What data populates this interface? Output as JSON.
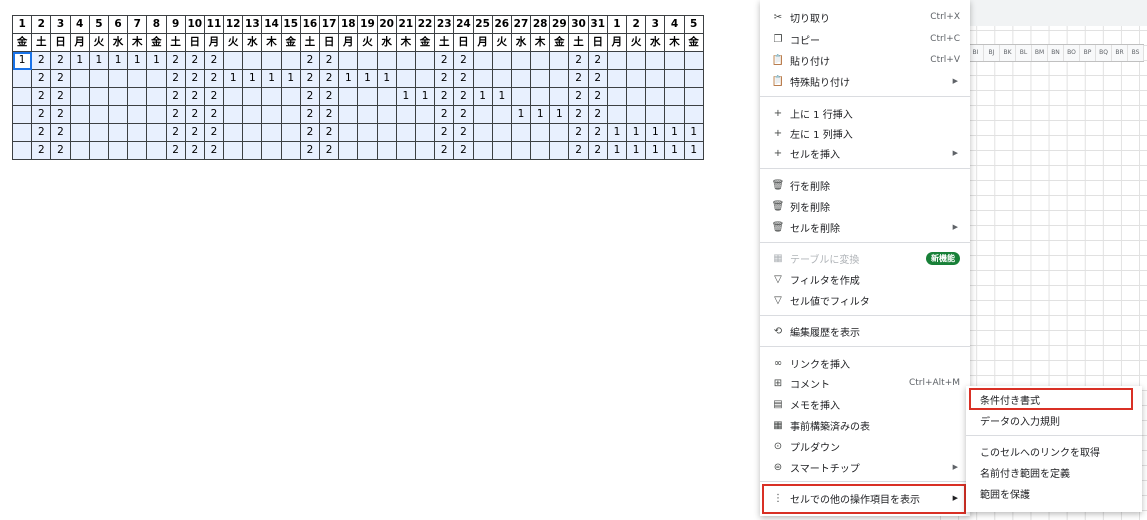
{
  "sheet": {
    "days": [
      "1",
      "2",
      "3",
      "4",
      "5",
      "6",
      "7",
      "8",
      "9",
      "10",
      "11",
      "12",
      "13",
      "14",
      "15",
      "16",
      "17",
      "18",
      "19",
      "20",
      "21",
      "22",
      "23",
      "24",
      "25",
      "26",
      "27",
      "28",
      "29",
      "30",
      "31",
      "1",
      "2",
      "3",
      "4",
      "5"
    ],
    "weekdays": [
      "金",
      "土",
      "日",
      "月",
      "火",
      "水",
      "木",
      "金",
      "土",
      "日",
      "月",
      "火",
      "水",
      "木",
      "金",
      "土",
      "日",
      "月",
      "火",
      "水",
      "木",
      "金",
      "土",
      "日",
      "月",
      "火",
      "水",
      "木",
      "金",
      "土",
      "日",
      "月",
      "火",
      "水",
      "木",
      "金"
    ],
    "rows": [
      [
        "1",
        "2",
        "2",
        "1",
        "1",
        "1",
        "1",
        "1",
        "2",
        "2",
        "2",
        "",
        "",
        "",
        "",
        "2",
        "2",
        "",
        "",
        "",
        "",
        "",
        "2",
        "2",
        "",
        "",
        "",
        "",
        "",
        "2",
        "2",
        "",
        "",
        "",
        "",
        ""
      ],
      [
        "",
        "2",
        "2",
        "",
        "",
        "",
        "",
        "",
        "2",
        "2",
        "2",
        "1",
        "1",
        "1",
        "1",
        "2",
        "2",
        "1",
        "1",
        "1",
        "",
        "",
        "2",
        "2",
        "",
        "",
        "",
        "",
        "",
        "2",
        "2",
        "",
        "",
        "",
        "",
        ""
      ],
      [
        "",
        "2",
        "2",
        "",
        "",
        "",
        "",
        "",
        "2",
        "2",
        "2",
        "",
        "",
        "",
        "",
        "2",
        "2",
        "",
        "",
        "",
        "1",
        "1",
        "2",
        "2",
        "1",
        "1",
        "",
        "",
        "",
        "2",
        "2",
        "",
        "",
        "",
        "",
        ""
      ],
      [
        "",
        "2",
        "2",
        "",
        "",
        "",
        "",
        "",
        "2",
        "2",
        "2",
        "",
        "",
        "",
        "",
        "2",
        "2",
        "",
        "",
        "",
        "",
        "",
        "2",
        "2",
        "",
        "",
        "1",
        "1",
        "1",
        "2",
        "2",
        "",
        "",
        "",
        "",
        ""
      ],
      [
        "",
        "2",
        "2",
        "",
        "",
        "",
        "",
        "",
        "2",
        "2",
        "2",
        "",
        "",
        "",
        "",
        "2",
        "2",
        "",
        "",
        "",
        "",
        "",
        "2",
        "2",
        "",
        "",
        "",
        "",
        "",
        "2",
        "2",
        "1",
        "1",
        "1",
        "1",
        "1"
      ],
      [
        "",
        "2",
        "2",
        "",
        "",
        "",
        "",
        "",
        "2",
        "2",
        "2",
        "",
        "",
        "",
        "",
        "2",
        "2",
        "",
        "",
        "",
        "",
        "",
        "2",
        "2",
        "",
        "",
        "",
        "",
        "",
        "2",
        "2",
        "1",
        "1",
        "1",
        "1",
        "1"
      ]
    ]
  },
  "bg_columns": [
    "BI",
    "BJ",
    "BK",
    "BL",
    "BM",
    "BN",
    "BO",
    "BP",
    "BQ",
    "BR",
    "BS"
  ],
  "menu": {
    "cut": {
      "label": "切り取り",
      "shortcut": "Ctrl+X",
      "icon": "scissors-icon"
    },
    "copy": {
      "label": "コピー",
      "shortcut": "Ctrl+C",
      "icon": "copy-icon"
    },
    "paste": {
      "label": "貼り付け",
      "shortcut": "Ctrl+V",
      "icon": "clipboard-icon"
    },
    "paste_special": {
      "label": "特殊貼り付け",
      "icon": "clipboard-icon"
    },
    "insert_row_above": {
      "label": "上に 1 行挿入",
      "icon": "plus-icon"
    },
    "insert_col_left": {
      "label": "左に 1 列挿入",
      "icon": "plus-icon"
    },
    "insert_cells": {
      "label": "セルを挿入",
      "icon": "plus-icon"
    },
    "delete_row": {
      "label": "行を削除",
      "icon": "trash-icon"
    },
    "delete_col": {
      "label": "列を削除",
      "icon": "trash-icon"
    },
    "delete_cells": {
      "label": "セルを削除",
      "icon": "trash-icon"
    },
    "convert_table": {
      "label": "テーブルに変換",
      "badge": "新機能",
      "icon": "table-icon"
    },
    "create_filter": {
      "label": "フィルタを作成",
      "icon": "filter-icon"
    },
    "filter_by_value": {
      "label": "セル値でフィルタ",
      "icon": "filter-icon"
    },
    "edit_history": {
      "label": "編集履歴を表示",
      "icon": "history-icon"
    },
    "insert_link": {
      "label": "リンクを挿入",
      "icon": "link-icon"
    },
    "comment": {
      "label": "コメント",
      "shortcut": "Ctrl+Alt+M",
      "icon": "comment-icon"
    },
    "insert_note": {
      "label": "メモを挿入",
      "icon": "note-icon"
    },
    "prebuilt_table": {
      "label": "事前構築済みの表",
      "icon": "table-icon"
    },
    "dropdown": {
      "label": "プルダウン",
      "icon": "dropdown-icon"
    },
    "smart_chip": {
      "label": "スマートチップ",
      "icon": "chip-icon"
    },
    "more_actions": {
      "label": "セルでの他の操作項目を表示",
      "icon": "more-vert-icon"
    }
  },
  "submenu": {
    "conditional_format": "条件付き書式",
    "data_validation": "データの入力規則",
    "get_link": "このセルへのリンクを取得",
    "named_range": "名前付き範囲を定義",
    "protect_range": "範囲を保護"
  },
  "colors": {
    "highlight": "#d93025",
    "selection": "#e8f0fe",
    "badge": "#188038"
  }
}
